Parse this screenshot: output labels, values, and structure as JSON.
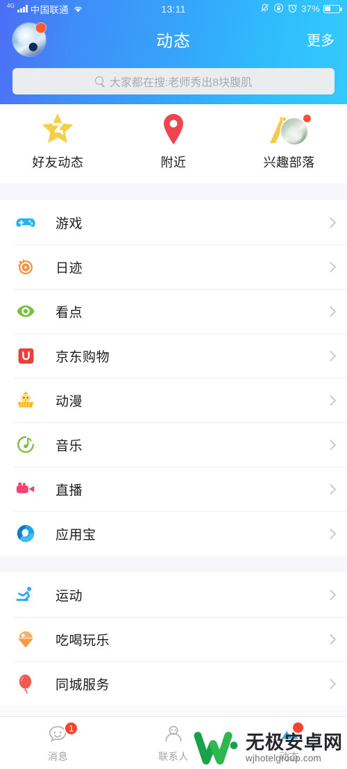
{
  "statusbar": {
    "network_label": "4G",
    "carrier": "中国联通",
    "time": "13:11",
    "battery_percent": "37%",
    "icons": [
      "signal-bars-icon",
      "wifi-icon",
      "mute-icon",
      "lock-icon",
      "alarm-icon",
      "battery-icon"
    ]
  },
  "header": {
    "title": "动态",
    "more_label": "更多",
    "avatar_has_badge": true,
    "gradient_from": "#4b6ef5",
    "gradient_to": "#35c9fe"
  },
  "search": {
    "placeholder": "大家都在搜:老师秀出8块腹肌",
    "icon": "search-icon"
  },
  "shortcuts": [
    {
      "label": "好友动态",
      "icon": "qzone-star-icon",
      "color": "#f7cf47"
    },
    {
      "label": "附近",
      "icon": "location-pin-icon",
      "color": "#ef4452"
    },
    {
      "label": "兴趣部落",
      "icon": "tribe-tent-icon",
      "color": "#f7c948",
      "badge": true
    }
  ],
  "list_groups": [
    {
      "items": [
        {
          "label": "游戏",
          "icon": "gamepad-icon",
          "color": "#25b3f0"
        },
        {
          "label": "日迹",
          "icon": "daily-play-icon",
          "color": "#f29346"
        },
        {
          "label": "看点",
          "icon": "eye-icon",
          "color": "#7ac143"
        },
        {
          "label": "京东购物",
          "icon": "jd-shopping-icon",
          "color": "#e8413c"
        },
        {
          "label": "动漫",
          "icon": "anime-chick-icon",
          "color": "#f5b722"
        },
        {
          "label": "音乐",
          "icon": "music-note-icon",
          "color": "#7ac143"
        },
        {
          "label": "直播",
          "icon": "live-camera-icon",
          "color": "#f4436d"
        },
        {
          "label": "应用宝",
          "icon": "myapp-icon",
          "color": "#2196f3"
        }
      ]
    },
    {
      "items": [
        {
          "label": "运动",
          "icon": "running-icon",
          "color": "#29a9f2"
        },
        {
          "label": "吃喝玩乐",
          "icon": "ice-cream-icon",
          "color": "#f59b42"
        },
        {
          "label": "同城服务",
          "icon": "balloon-icon",
          "color": "#ee5a52"
        }
      ]
    }
  ],
  "chevron_icon": "chevron-right-icon",
  "tabbar": [
    {
      "label": "消息",
      "icon": "message-icon",
      "badge": "1"
    },
    {
      "label": "联系人",
      "icon": "contacts-icon",
      "badge": ""
    },
    {
      "label": "动态",
      "icon": "dynamic-icon",
      "badge": ""
    }
  ],
  "watermark": {
    "name_cn": "无极安卓网",
    "name_en": "wjhotelgroup.com",
    "logo": "w-logo-icon",
    "color": "#17a34a"
  }
}
